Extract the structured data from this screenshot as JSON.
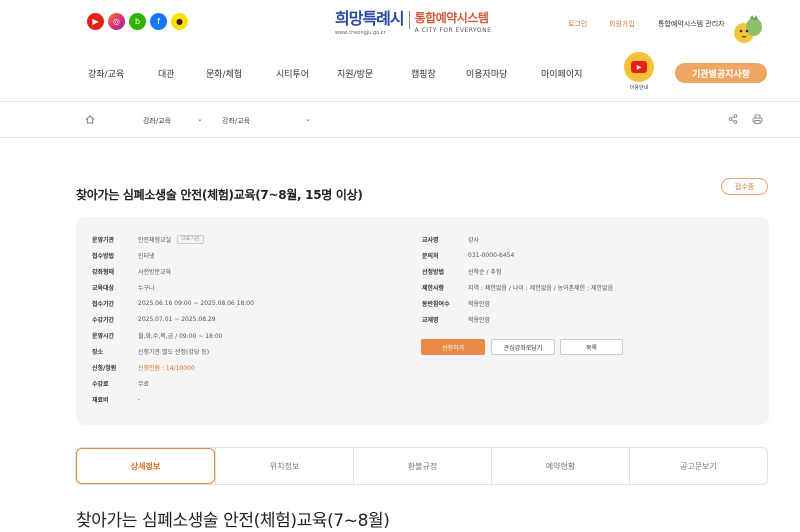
{
  "header": {
    "social": [
      {
        "name": "youtube",
        "glyph": "▶"
      },
      {
        "name": "instagram",
        "glyph": "◎"
      },
      {
        "name": "blog",
        "glyph": "b"
      },
      {
        "name": "facebook",
        "glyph": "f"
      },
      {
        "name": "kakao",
        "glyph": "●"
      }
    ],
    "logo": {
      "main": "희망특례시",
      "main_sub": "www.cheongju.go.kr",
      "system": "통합예약시스템",
      "system_sub": "A CITY FOR EVERYONE"
    },
    "util": {
      "login": "로그인",
      "join": "회원가입",
      "admin": "통합예약시스템 관리자"
    },
    "gnb": [
      "강좌/교육",
      "대관",
      "문화/체험",
      "시티투어",
      "지원/방문",
      "캠핑장",
      "이용자마당",
      "마이페이지"
    ],
    "youtube_label": "이용안내",
    "notice_button": "기관별공지사항"
  },
  "breadcrumb": {
    "level1": "강좌/교육",
    "level2": "강좌/교육"
  },
  "page": {
    "title": "찾아가는 심폐소생술 안전(체험)교육(7~8월, 15명 이상)",
    "status": "접수중"
  },
  "info_left": [
    {
      "label": "운영기관",
      "value": "안전체험교실",
      "tag": "대표기관"
    },
    {
      "label": "접수방법",
      "value": "인터넷"
    },
    {
      "label": "강좌형태",
      "value": "사전방문교육"
    },
    {
      "label": "교육대상",
      "value": "누구나"
    },
    {
      "label": "접수기간",
      "value": "2025.06.16 09:00 ~ 2025.08.06 18:00"
    },
    {
      "label": "수강기간",
      "value": "2025.07.01 ~ 2025.08.29"
    },
    {
      "label": "운영시간",
      "value": "월,화,수,목,금 / 09:00 ~ 18:00"
    },
    {
      "label": "장소",
      "value": "신청기관 별도 선정(강당 등)"
    },
    {
      "label": "신청/정원",
      "value": "신청인원 : 14/10000",
      "highlight": true
    },
    {
      "label": "수강료",
      "value": "무료"
    },
    {
      "label": "재료비",
      "value": "-"
    }
  ],
  "info_right": [
    {
      "label": "교사명",
      "value": "강사"
    },
    {
      "label": "문의처",
      "value": "031-0000-6454"
    },
    {
      "label": "선정방법",
      "value": "선착순 / 추첨"
    },
    {
      "label": "제한사항",
      "value": "지역 : 제한없음 / 나이 : 제한없음 / 농어촌제한 : 제한없음"
    },
    {
      "label": "동반참여수",
      "value": "적용안함"
    },
    {
      "label": "교재명",
      "value": "적용안함"
    }
  ],
  "actions": {
    "apply": "신청하기",
    "favorite": "관심강좌로담기",
    "list": "목록"
  },
  "tabs": [
    "상세정보",
    "위치정보",
    "환불규정",
    "예약현황",
    "공고문보기"
  ],
  "content_title": "찾아가는 심폐소생술 안전(체험)교육(7~8월)",
  "colors": {
    "accent": "#e88a45",
    "brand_blue": "#2a4aa0",
    "panel_bg": "#f5f5f5"
  }
}
